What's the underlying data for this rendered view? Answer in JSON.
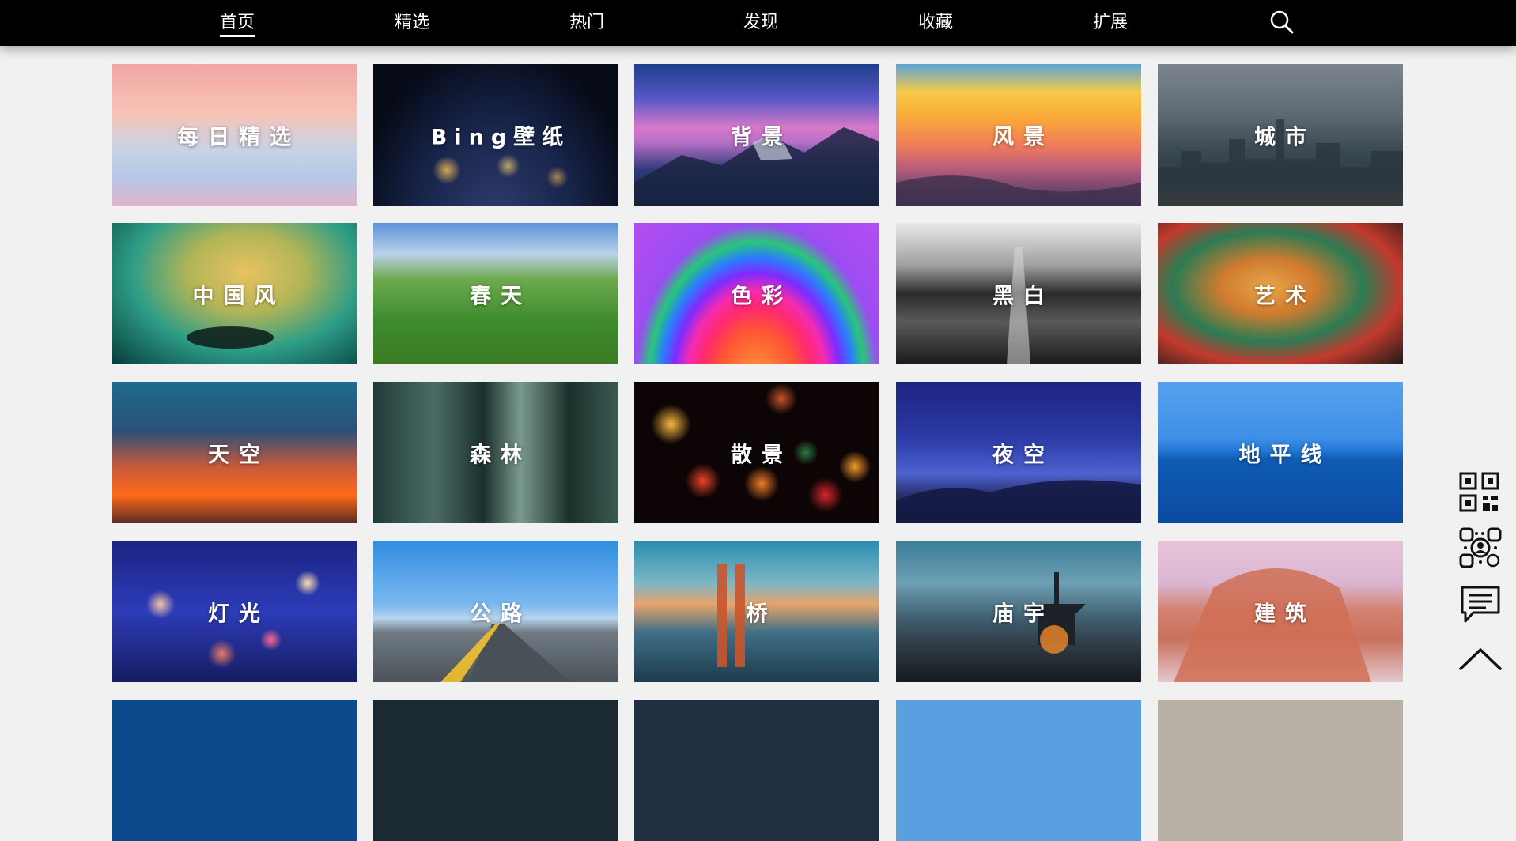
{
  "nav": {
    "items": [
      {
        "label": "首页",
        "active": true
      },
      {
        "label": "精选",
        "active": false
      },
      {
        "label": "热门",
        "active": false
      },
      {
        "label": "发现",
        "active": false
      },
      {
        "label": "收藏",
        "active": false
      },
      {
        "label": "扩展",
        "active": false
      }
    ],
    "search_icon": "search-icon"
  },
  "categories": [
    {
      "label": "每日精选"
    },
    {
      "label": "Bing壁纸"
    },
    {
      "label": "背景"
    },
    {
      "label": "风景"
    },
    {
      "label": "城市"
    },
    {
      "label": "中国风"
    },
    {
      "label": "春天"
    },
    {
      "label": "色彩"
    },
    {
      "label": "黑白"
    },
    {
      "label": "艺术"
    },
    {
      "label": "天空"
    },
    {
      "label": "森林"
    },
    {
      "label": "散景"
    },
    {
      "label": "夜空"
    },
    {
      "label": "地平线"
    },
    {
      "label": "灯光"
    },
    {
      "label": "公路"
    },
    {
      "label": "桥"
    },
    {
      "label": "庙宇"
    },
    {
      "label": "建筑"
    }
  ],
  "side_tools": [
    {
      "icon": "qr-code-icon"
    },
    {
      "icon": "mini-program-code-icon"
    },
    {
      "icon": "comment-icon"
    },
    {
      "icon": "back-to-top-icon"
    }
  ],
  "colors": {
    "nav_bg": "#000000",
    "page_bg": "#f1f1f1",
    "text_on_tile": "#ffffff"
  }
}
